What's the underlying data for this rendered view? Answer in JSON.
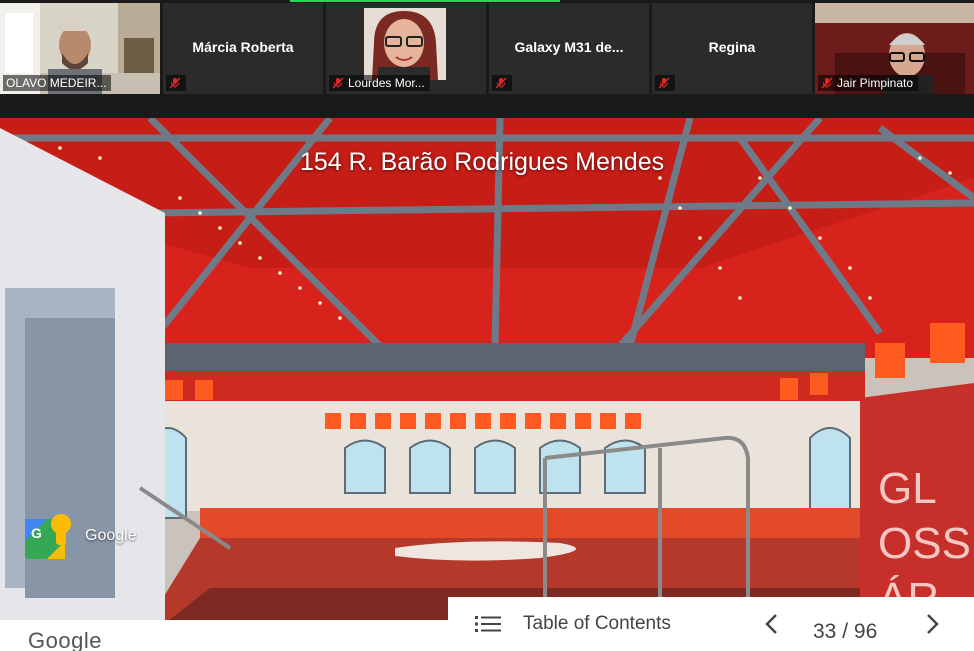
{
  "participants": [
    {
      "name": "OLAVO MEDEIR...",
      "has_video": true,
      "muted": true,
      "active": true
    },
    {
      "name": "Márcia Roberta",
      "has_video": false,
      "muted": true,
      "active": false
    },
    {
      "name": "Lourdes Mor...",
      "has_video": true,
      "muted": true,
      "active": false
    },
    {
      "name": "Galaxy M31 de...",
      "has_video": false,
      "muted": true,
      "active": false
    },
    {
      "name": "Regina",
      "has_video": false,
      "muted": true,
      "active": false
    },
    {
      "name": "Jair Pimpinato",
      "has_video": true,
      "muted": true,
      "active": false
    }
  ],
  "street_view": {
    "address": "154 R. Barão Rodrigues Mendes",
    "badge_label": "Google",
    "footer_logo": "Google",
    "wall_letters": [
      "GL",
      "OSS",
      "ÁR"
    ]
  },
  "toc": {
    "label": "Table of Contents",
    "current_page": "33",
    "total_pages": "96",
    "separator": "/"
  },
  "colors": {
    "speaking_indicator": "#23d959",
    "muted_icon": "#e02828",
    "ceiling_red": "#d8231c"
  }
}
